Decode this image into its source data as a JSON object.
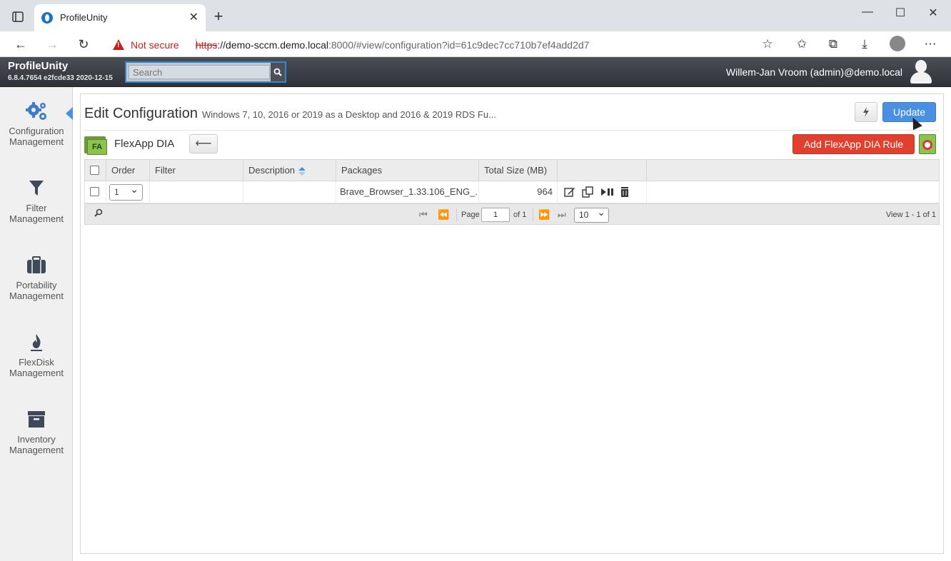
{
  "browser": {
    "tab_title": "ProfileUnity",
    "security_label": "Not secure",
    "url_scheme": "https",
    "url_host": "://demo-sccm.demo.local",
    "url_rest": ":8000/#view/configuration?id=61c9dec7cc710b7ef4add2d7"
  },
  "header": {
    "brand": "ProfileUnity",
    "version": "6.8.4.7654 e2fcde33 2020-12-15",
    "search_placeholder": "Search",
    "user": "Willem-Jan Vroom (admin)@demo.local"
  },
  "sidebar": {
    "items": [
      {
        "line1": "Configuration",
        "line2": "Management",
        "icon": "gears-icon"
      },
      {
        "line1": "Filter",
        "line2": "Management",
        "icon": "filter-icon"
      },
      {
        "line1": "Portability",
        "line2": "Management",
        "icon": "briefcase-icon"
      },
      {
        "line1": "FlexDisk",
        "line2": "Management",
        "icon": "flame-icon"
      },
      {
        "line1": "Inventory",
        "line2": "Management",
        "icon": "archive-box-icon"
      }
    ]
  },
  "main": {
    "title": "Edit Configuration",
    "description": "Windows 7, 10, 2016 or 2019 as a Desktop and 2016 & 2019 RDS Fu...",
    "update_label": "Update",
    "section_title": "FlexApp DIA",
    "flex_badge": "FA",
    "add_rule_label": "Add FlexApp DIA Rule"
  },
  "grid": {
    "columns": [
      "Order",
      "Filter",
      "Description",
      "Packages",
      "Total Size (MB)"
    ],
    "rows": [
      {
        "order": "1",
        "filter": "",
        "description": "",
        "packages": "Brave_Browser_1.33.106_ENG_...",
        "total_size": "964"
      }
    ],
    "pager": {
      "page_label": "Page",
      "page": "1",
      "of_label": "of 1",
      "page_size": "10",
      "view_label": "View 1 - 1 of 1"
    }
  },
  "colors": {
    "accent": "#4a90e2",
    "danger": "#e2402f",
    "header_bg": "#3a3d43"
  }
}
